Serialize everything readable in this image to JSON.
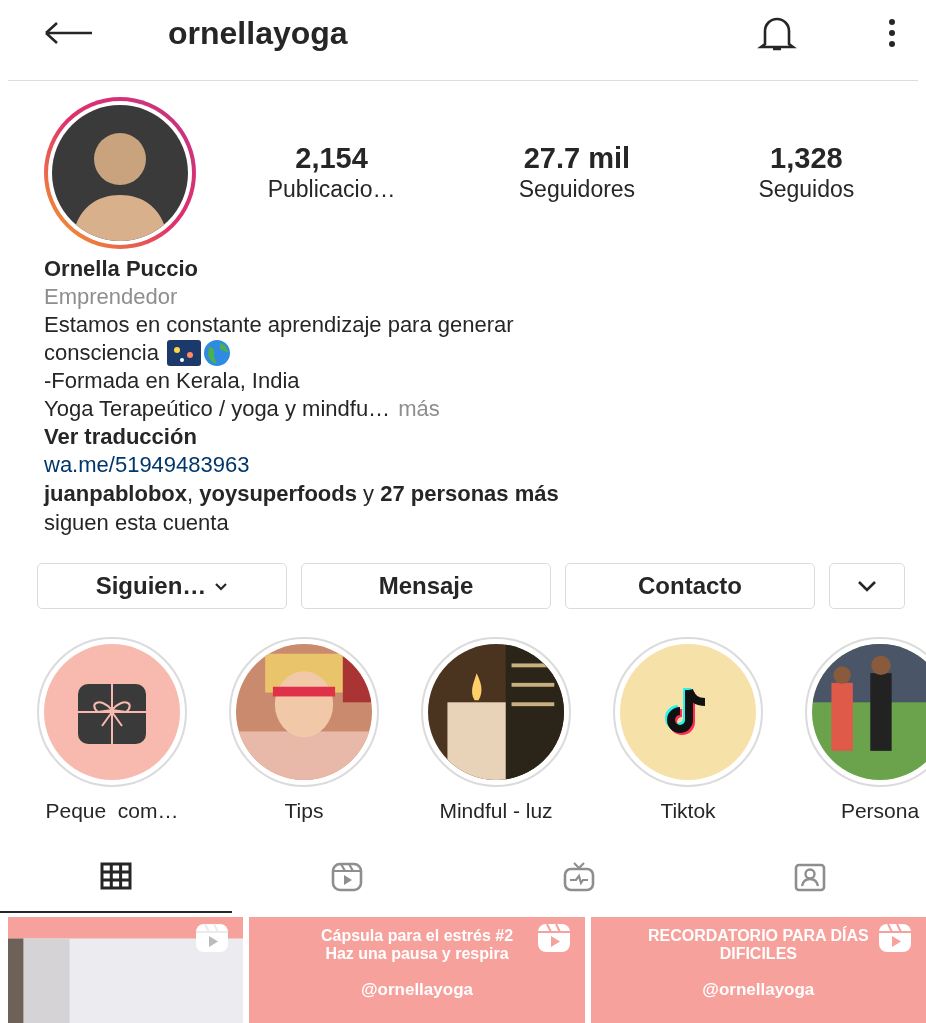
{
  "header": {
    "username": "ornellayoga"
  },
  "profile": {
    "stats": [
      {
        "value": "2,154",
        "label": "Publicacio…"
      },
      {
        "value": "27.7 mil",
        "label": "Seguidores"
      },
      {
        "value": "1,328",
        "label": "Seguidos"
      }
    ],
    "name": "Ornella Puccio",
    "category": "Emprendedor",
    "bio": [
      {
        "text": "Estamos en constante aprendizaje para generar"
      },
      {
        "text": "consciencia",
        "trailing_icons": true
      },
      {
        "text": "-Formada en Kerala, India"
      },
      {
        "text": "Yoga Terapeútico / yoga y mindfu…",
        "more": "más"
      }
    ],
    "translate": "Ver traducción",
    "link": "wa.me/51949483963",
    "followed_by": [
      "**juanpablobox**, **yoysuperfoods** y **27 personas más**",
      "siguen esta cuenta"
    ]
  },
  "buttons": [
    {
      "kind": "text",
      "label": "Siguien…",
      "caret": true
    },
    {
      "kind": "text",
      "label": "Mensaje",
      "caret": false
    },
    {
      "kind": "text",
      "label": "Contacto",
      "caret": false
    },
    {
      "kind": "icon",
      "caret": true
    }
  ],
  "highlights": [
    {
      "label": "Peque  com…",
      "kind": "gift"
    },
    {
      "label": "Tips",
      "kind": "picture"
    },
    {
      "label": "Mindful - luz",
      "kind": "picture"
    },
    {
      "label": "Tiktok",
      "kind": "tiktok"
    },
    {
      "label": "Persona",
      "kind": "picture"
    }
  ],
  "tabs": [
    {
      "kind": "grid",
      "selected": true
    },
    {
      "kind": "reels",
      "selected": false
    },
    {
      "kind": "igtv",
      "selected": false
    },
    {
      "kind": "tagged",
      "selected": false
    }
  ],
  "posts": [
    {
      "kind": "picture",
      "reel": true
    },
    {
      "kind": "text",
      "lines": [
        "Cápsula para el estrés #2",
        "Haz una pausa y respira"
      ],
      "handle": "@ornellayoga",
      "reel": true
    },
    {
      "kind": "text",
      "lines": [
        "RECORDATORIO PARA DÍAS DIFICILES"
      ],
      "handle": "@ornellayoga",
      "reel": true
    }
  ]
}
